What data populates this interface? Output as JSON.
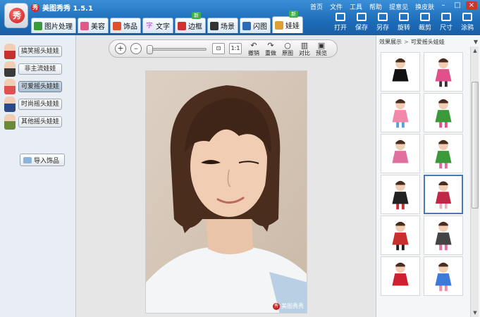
{
  "app": {
    "title": "美图秀秀 1.5.1",
    "logo_glyph": "秀",
    "mini_glyph": "秀"
  },
  "menu": [
    "首页",
    "文件",
    "工具",
    "帮助",
    "提意见",
    "换皮肤"
  ],
  "window_controls": {
    "minimize": "–",
    "maximize": "□",
    "close": "×"
  },
  "tabs": [
    {
      "label": "图片处理",
      "icon": "image-edit-icon",
      "color": "#3a9a3a"
    },
    {
      "label": "美容",
      "icon": "face-icon",
      "color": "#e05a8a"
    },
    {
      "label": "饰品",
      "icon": "heart-icon",
      "color": "#e0502a"
    },
    {
      "label": "文字",
      "icon": "text-icon",
      "glyph": "字",
      "color": "#a050c8"
    },
    {
      "label": "边框",
      "icon": "frame-icon",
      "color": "#d03030",
      "badge": "新"
    },
    {
      "label": "场景",
      "icon": "scene-icon",
      "color": "#333333"
    },
    {
      "label": "闪图",
      "icon": "flash-icon",
      "color": "#2a6ab8"
    },
    {
      "label": "娃娃",
      "icon": "doll-icon",
      "color": "#e0a030",
      "badge": "新",
      "active": true
    }
  ],
  "tools": [
    {
      "label": "打开",
      "icon": "open-folder-icon"
    },
    {
      "label": "保存",
      "icon": "save-icon"
    },
    {
      "label": "另存",
      "icon": "save-as-icon"
    },
    {
      "label": "旋转",
      "icon": "rotate-icon"
    },
    {
      "label": "裁剪",
      "icon": "crop-icon"
    },
    {
      "label": "尺寸",
      "icon": "resize-icon"
    },
    {
      "label": "涂鸦",
      "icon": "brush-icon"
    }
  ],
  "left_panel": {
    "categories": [
      {
        "label": "搞笑摇头娃娃",
        "color": "#c83030"
      },
      {
        "label": "非主流娃娃",
        "color": "#3a3a3a"
      },
      {
        "label": "可爱摇头娃娃",
        "color": "#e05050",
        "active": true
      },
      {
        "label": "时尚摇头娃娃",
        "color": "#2a4a8a"
      },
      {
        "label": "其他摇头娃娃",
        "color": "#6a8a3a"
      }
    ],
    "import_label": "导入饰品"
  },
  "canvas_toolbar": {
    "zoom_in": "+",
    "zoom_out": "–",
    "zoom_level": 0,
    "actions": [
      {
        "label": "撤销",
        "glyph": "↶"
      },
      {
        "label": "重做",
        "glyph": "↷"
      },
      {
        "label": "原图",
        "glyph": "○"
      },
      {
        "label": "对比",
        "glyph": "▥"
      },
      {
        "label": "预览",
        "glyph": "▣"
      }
    ]
  },
  "photo": {
    "watermark": "美图秀秀",
    "watermark_glyph": "秀"
  },
  "right_panel": {
    "breadcrumb_root": "效果展示",
    "breadcrumb_sep": ">",
    "breadcrumb_current": "可爱摇头娃娃",
    "dropdown_glyph": "▼",
    "selected_index": 7,
    "items": [
      {
        "name": "sticker-black-outfit"
      },
      {
        "name": "sticker-pink-monster-drum"
      },
      {
        "name": "sticker-pink-dress"
      },
      {
        "name": "sticker-green-pants-girl"
      },
      {
        "name": "sticker-pink-pig"
      },
      {
        "name": "sticker-girls-group"
      },
      {
        "name": "sticker-black-devil"
      },
      {
        "name": "sticker-red-gown"
      },
      {
        "name": "sticker-red-dancer"
      },
      {
        "name": "sticker-lying-figure"
      },
      {
        "name": "sticker-red-bird"
      },
      {
        "name": "sticker-blue-dancer"
      }
    ]
  }
}
